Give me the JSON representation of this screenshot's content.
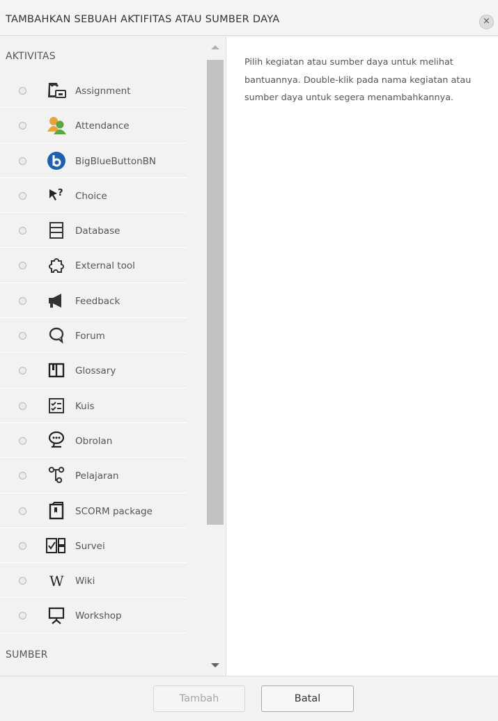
{
  "dialog": {
    "title": "TAMBAHKAN SEBUAH AKTIFITAS ATAU SUMBER DAYA",
    "close_icon": "×"
  },
  "activities_section": {
    "label": "AKTIVITAS",
    "items": [
      {
        "label": "Assignment",
        "icon": "assignment-icon"
      },
      {
        "label": "Attendance",
        "icon": "attendance-icon"
      },
      {
        "label": "BigBlueButtonBN",
        "icon": "bigbluebutton-icon"
      },
      {
        "label": "Choice",
        "icon": "choice-icon"
      },
      {
        "label": "Database",
        "icon": "database-icon"
      },
      {
        "label": "External tool",
        "icon": "external-tool-icon"
      },
      {
        "label": "Feedback",
        "icon": "feedback-icon"
      },
      {
        "label": "Forum",
        "icon": "forum-icon"
      },
      {
        "label": "Glossary",
        "icon": "glossary-icon"
      },
      {
        "label": "Kuis",
        "icon": "quiz-icon"
      },
      {
        "label": "Obrolan",
        "icon": "chat-icon"
      },
      {
        "label": "Pelajaran",
        "icon": "lesson-icon"
      },
      {
        "label": "SCORM package",
        "icon": "scorm-icon"
      },
      {
        "label": "Survei",
        "icon": "survey-icon"
      },
      {
        "label": "Wiki",
        "icon": "wiki-icon"
      },
      {
        "label": "Workshop",
        "icon": "workshop-icon"
      }
    ]
  },
  "resources_section": {
    "label": "SUMBER"
  },
  "help": {
    "text": "Pilih kegiatan atau sumber daya untuk melihat bantuannya. Double-klik pada nama kegiatan atau sumber daya untuk segera menambahkannya."
  },
  "footer": {
    "add_label": "Tambah",
    "cancel_label": "Batal"
  },
  "colors": {
    "pane_bg": "#f2f2f2",
    "header_bg": "#f4f4f4",
    "attendance_orange": "#e8a33d",
    "attendance_green": "#58a83c",
    "bigbluebutton_blue": "#1e5fae"
  }
}
